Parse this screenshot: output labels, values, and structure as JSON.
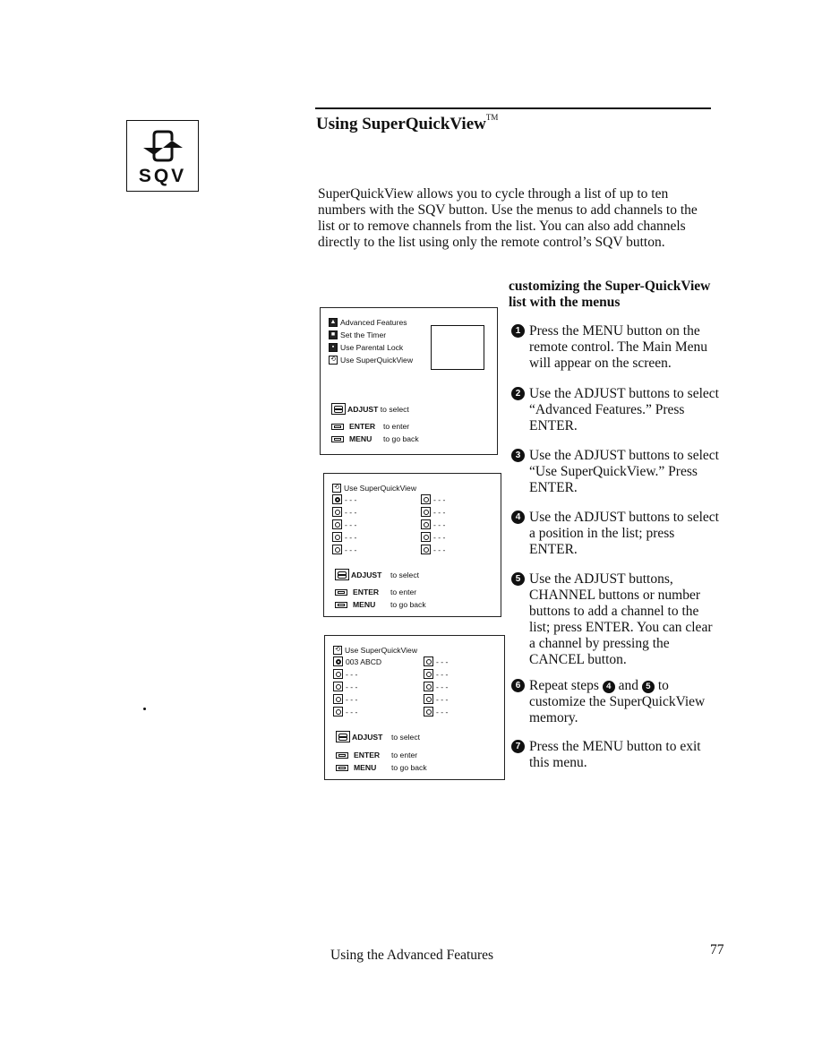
{
  "sidebar_icon": {
    "name": "sqv-icon",
    "label": "SQV"
  },
  "header": {
    "title": "Using SuperQuickView",
    "trademark": "TM"
  },
  "intro": "SuperQuickView allows you to cycle through a list of up to ten numbers with the SQV button.  Use the menus to add channels to the list or to remove channels from the list. You can also add channels directly to the list using only the remote control’s SQV button.",
  "screens": {
    "advanced_menu": {
      "items": [
        {
          "icon": "advanced-features-icon",
          "label": "Advanced Features"
        },
        {
          "icon": "timer-icon",
          "label": "Set the Timer"
        },
        {
          "icon": "lock-icon",
          "label": "Use Parental Lock"
        },
        {
          "icon": "sqv-icon",
          "label": "Use SuperQuickView"
        }
      ],
      "legend": [
        {
          "key": "ADJUST",
          "desc": "to select"
        },
        {
          "key": "ENTER",
          "desc": "to enter"
        },
        {
          "key": "MENU",
          "desc": "to go back"
        }
      ]
    },
    "sqv_empty": {
      "title": "Use SuperQuickView",
      "slots_left": [
        "- - -",
        "- - -",
        "- - -",
        "- - -",
        "- - -"
      ],
      "slots_right": [
        "- - -",
        "- - -",
        "- - -",
        "- - -",
        "- - -"
      ],
      "legend": [
        {
          "key": "ADJUST",
          "desc": "to select"
        },
        {
          "key": "ENTER",
          "desc": "to enter"
        },
        {
          "key": "MENU",
          "desc": "to go back"
        }
      ]
    },
    "sqv_filled": {
      "title": "Use SuperQuickView",
      "slots_left": [
        "003 ABCD",
        "- - -",
        "- - -",
        "- - -",
        "- - -"
      ],
      "slots_right": [
        "- - -",
        "- - -",
        "- - -",
        "- - -",
        "- - -"
      ],
      "legend": [
        {
          "key": "ADJUST",
          "desc": "to select"
        },
        {
          "key": "ENTER",
          "desc": "to enter"
        },
        {
          "key": "MENU",
          "desc": "to go back"
        }
      ]
    }
  },
  "instructions": {
    "heading": "customizing the Super-QuickView list with the menus",
    "steps": [
      {
        "num": "1",
        "text": "Press the MENU button on the remote control. The Main Menu will appear on the screen."
      },
      {
        "num": "2",
        "text": "Use the ADJUST buttons to select “Advanced Features.” Press ENTER."
      },
      {
        "num": "3",
        "text": "Use the ADJUST buttons to select “Use SuperQuickView.” Press ENTER."
      },
      {
        "num": "4",
        "text": "Use the ADJUST buttons to select a position in the list; press ENTER."
      },
      {
        "num": "5",
        "text": "Use the ADJUST buttons, CHANNEL buttons or number buttons to add a channel to the list; press ENTER. You can clear a channel by pressing the CANCEL button."
      },
      {
        "num": "6",
        "text_a": "Repeat steps",
        "ref1": "4",
        "text_b": "and",
        "ref2": "5",
        "text_c": "to customize the SuperQuickView memory."
      },
      {
        "num": "7",
        "text": "Press the MENU button to exit this menu."
      }
    ]
  },
  "footer": {
    "section": "Using the Advanced Features",
    "page": "77"
  }
}
